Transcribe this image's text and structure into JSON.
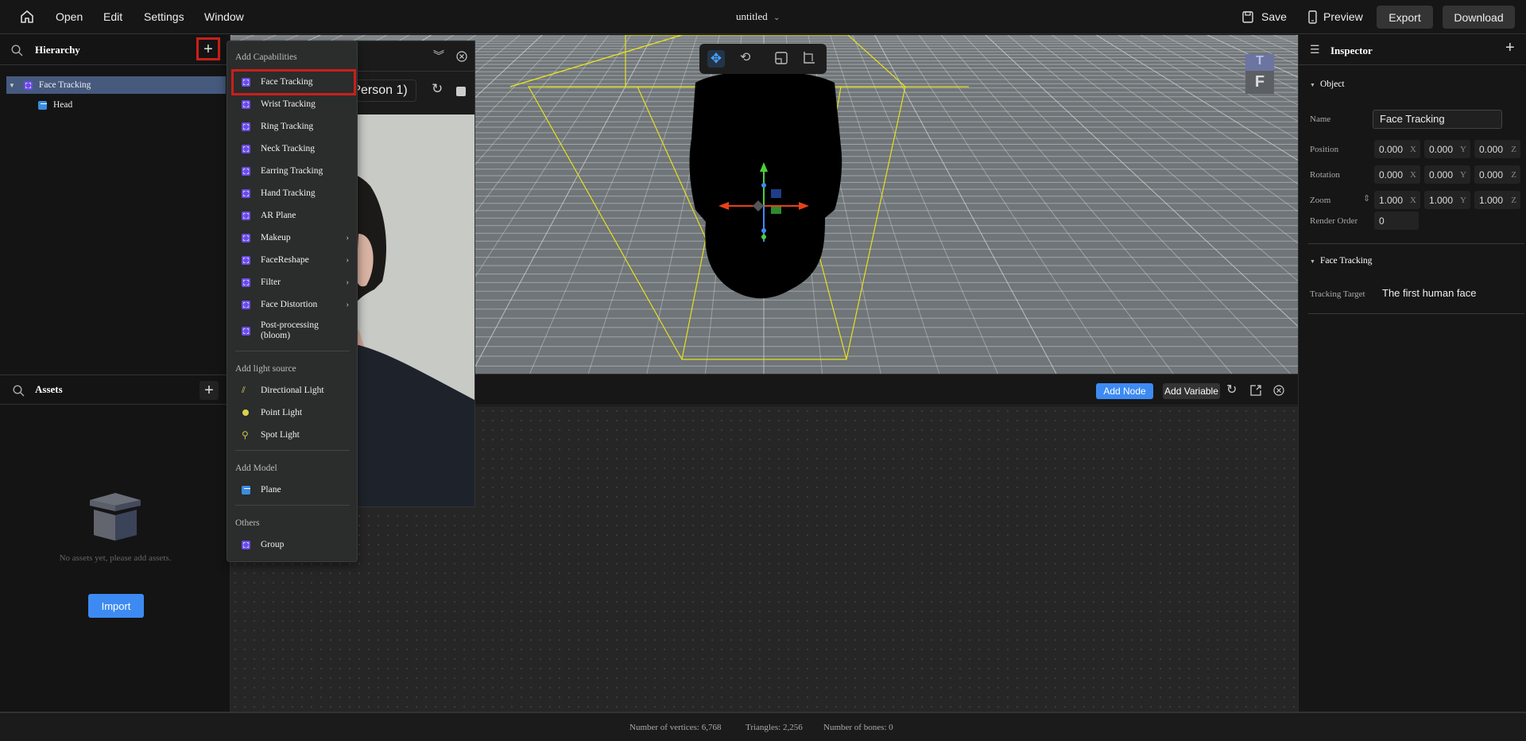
{
  "topbar": {
    "menu": [
      "Open",
      "Edit",
      "Settings",
      "Window"
    ],
    "title": "untitled",
    "save": "Save",
    "preview": "Preview",
    "export": "Export",
    "download": "Download"
  },
  "hierarchy": {
    "title": "Hierarchy",
    "items": [
      {
        "label": "Face Tracking",
        "selected": true
      },
      {
        "label": "Head"
      }
    ]
  },
  "assets": {
    "title": "Assets",
    "empty_text": "No assets yet, please add assets.",
    "import": "Import"
  },
  "add_menu": {
    "sections": [
      {
        "title": "Add Capabilities",
        "items": [
          "Face Tracking",
          "Wrist Tracking",
          "Ring Tracking",
          "Neck Tracking",
          "Earring Tracking",
          "Hand Tracking",
          "AR Plane",
          "Makeup",
          "FaceReshape",
          "Filter",
          "Face Distortion",
          "Post-processing (bloom)"
        ]
      },
      {
        "title": "Add light source",
        "items": [
          "Directional Light",
          "Point Light",
          "Spot Light"
        ]
      },
      {
        "title": "Add Model",
        "items": [
          "Plane"
        ]
      },
      {
        "title": "Others",
        "items": [
          "Group"
        ]
      }
    ],
    "submenu_items": [
      "Makeup",
      "FaceReshape",
      "Filter",
      "Face Distortion"
    ],
    "highlighted": "Face Tracking"
  },
  "preview": {
    "person_select": "(Person 1)"
  },
  "viewport": {
    "tools": [
      "move",
      "rotate",
      "scale",
      "transform"
    ],
    "active_tool": "move",
    "axis_cube": {
      "top": "T",
      "front": "F"
    }
  },
  "nodebar": {
    "add_node": "Add Node",
    "add_variable": "Add Variable"
  },
  "inspector": {
    "title": "Inspector",
    "object_section": "Object",
    "name_label": "Name",
    "name_value": "Face Tracking",
    "position_label": "Position",
    "position": [
      "0.000",
      "0.000",
      "0.000"
    ],
    "rotation_label": "Rotation",
    "rotation": [
      "0.000",
      "0.000",
      "0.000"
    ],
    "zoom_label": "Zoom",
    "zoom": [
      "1.000",
      "1.000",
      "1.000"
    ],
    "axes": [
      "X",
      "Y",
      "Z"
    ],
    "render_order_label": "Render Order",
    "render_order": "0",
    "face_section": "Face Tracking",
    "tracking_target_label": "Tracking Target",
    "tracking_target": "The first human face"
  },
  "status": {
    "vertices": "Number of vertices: 6,768",
    "triangles": "Triangles: 2,256",
    "bones": "Number of bones: 0"
  },
  "colors": {
    "accent": "#3d8bf2",
    "highlight_box": "#c8201a",
    "capability_icon": "#6b4ce6",
    "model_icon": "#3a8de0",
    "frustum": "#e6e01c"
  }
}
